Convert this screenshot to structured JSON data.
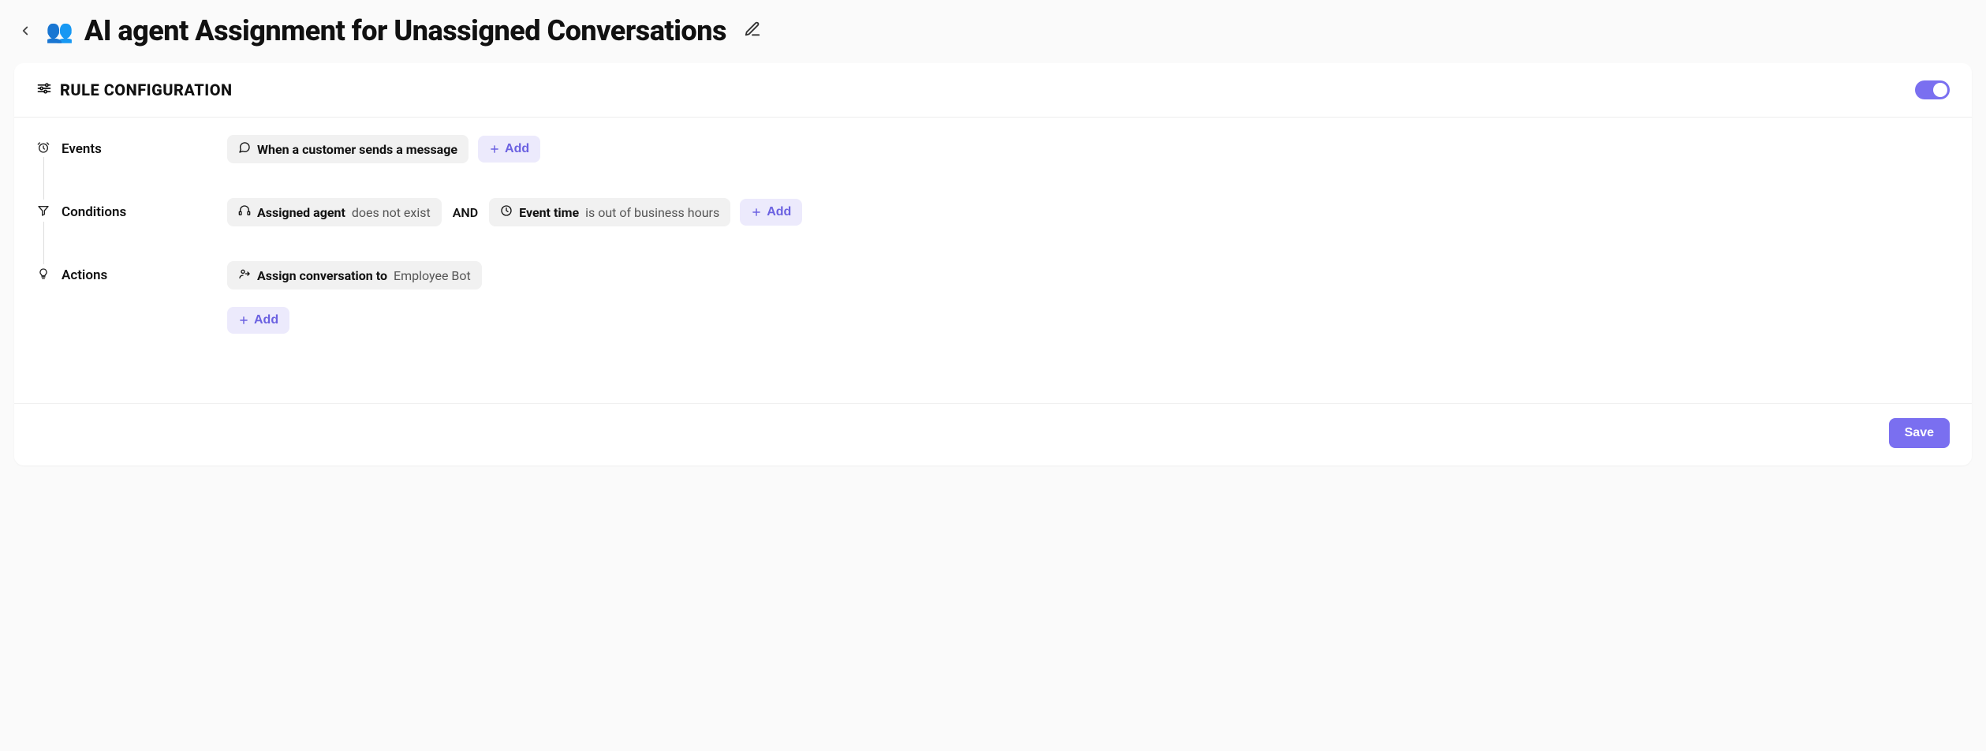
{
  "header": {
    "emoji": "👥",
    "title": "AI agent Assignment for Unassigned Conversations"
  },
  "section": {
    "title": "RULE CONFIGURATION",
    "enabled": true
  },
  "events": {
    "label": "Events",
    "items": [
      {
        "text": "When a customer sends a message"
      }
    ],
    "add_label": "Add"
  },
  "conditions": {
    "label": "Conditions",
    "joiner": "AND",
    "items": [
      {
        "subject": "Assigned agent",
        "predicate": "does not exist"
      },
      {
        "subject": "Event time",
        "predicate": "is out of business hours"
      }
    ],
    "add_label": "Add"
  },
  "actions": {
    "label": "Actions",
    "items": [
      {
        "subject": "Assign conversation to",
        "target": "Employee Bot"
      }
    ],
    "add_label": "Add"
  },
  "footer": {
    "save_label": "Save"
  }
}
